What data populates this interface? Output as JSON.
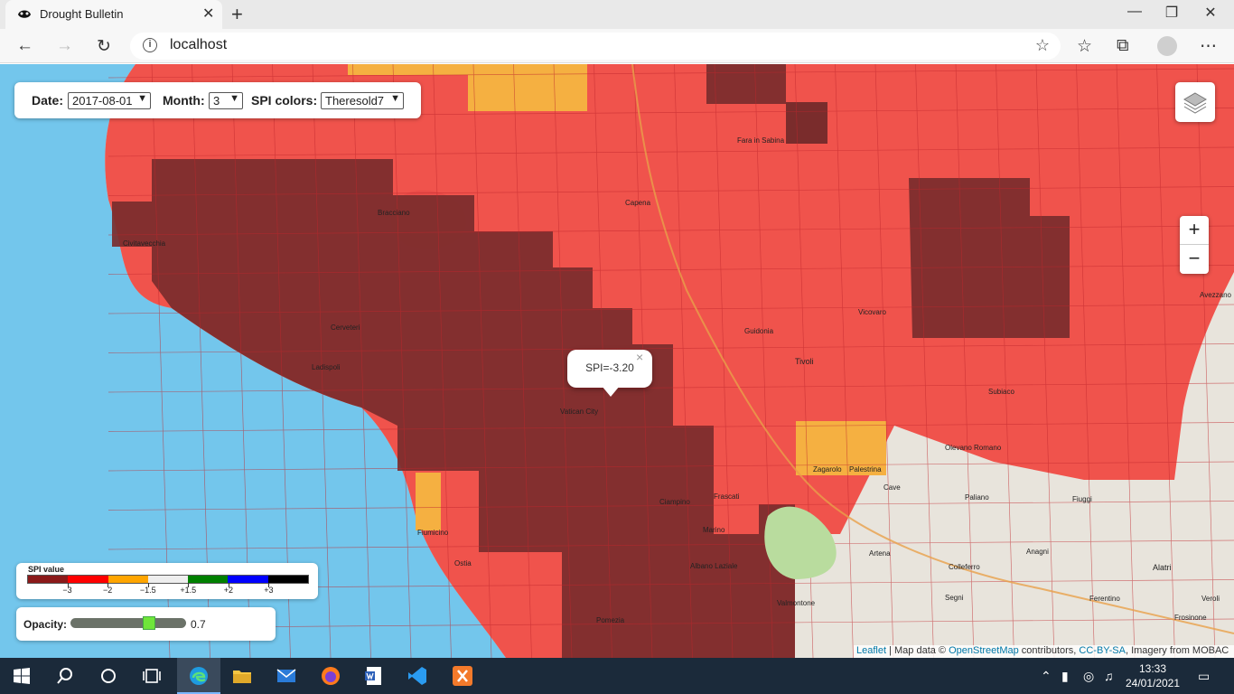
{
  "browser": {
    "tab_title": "Drought Bulletin",
    "tab_close": "✕",
    "new_tab": "+",
    "address": "localhost",
    "minimize": "—",
    "restore": "❐",
    "close": "✕"
  },
  "controls": {
    "date_label": "Date:",
    "date_value": "2017-08-01",
    "month_label": "Month:",
    "month_value": "3",
    "spi_label": "SPI colors:",
    "spi_value": "Theresold7"
  },
  "zoom": {
    "in": "+",
    "out": "−"
  },
  "popup": {
    "text": "SPI=-3.20",
    "close": "×"
  },
  "legend": {
    "title": "SPI value",
    "colors": [
      "#8b1a1a",
      "#ff0000",
      "#ffa500",
      "#eeeeee",
      "#008000",
      "#0000ff",
      "#000000"
    ],
    "labels": [
      "−3",
      "−2",
      "−1.5",
      "+1.5",
      "+2",
      "+3"
    ]
  },
  "opacity": {
    "label": "Opacity:",
    "value": "0.7",
    "level": 0.7
  },
  "attribution": {
    "leaflet": "Leaflet",
    "sep": " | Map data © ",
    "osm": "OpenStreetMap",
    "contrib": " contributors, ",
    "license": "CC-BY-SA",
    "imagery": ", Imagery from MOBAC"
  },
  "map_labels": [
    "Civitavecchia",
    "Tivoli",
    "Fiumicino",
    "Pomezia",
    "Zagarolo",
    "Palestrina",
    "Cave",
    "Colleferro",
    "Alatri",
    "Frosinone",
    "Avezzano",
    "Fiuggi",
    "Anagni",
    "Artena",
    "Segni",
    "Ferentino",
    "Veroli",
    "Valmontone",
    "Marino",
    "Albano Laziale",
    "Ciampino",
    "Frascati",
    "Bracciano",
    "Cerveteri",
    "Ladispoli",
    "Ostia",
    "Fara in Sabina",
    "Capena",
    "Subiaco",
    "Vicovaro",
    "Vatican City",
    "Olevano Romano",
    "Paliano",
    "Guidonia"
  ],
  "taskbar": {
    "time": "13:33",
    "date": "24/01/2021"
  }
}
